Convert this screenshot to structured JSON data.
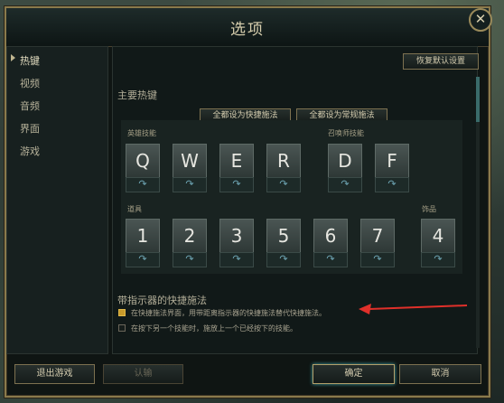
{
  "dialog": {
    "title": "选项",
    "close_icon": "✕"
  },
  "sidebar": {
    "items": [
      {
        "label": "热键",
        "active": true
      },
      {
        "label": "视频",
        "active": false
      },
      {
        "label": "音频",
        "active": false
      },
      {
        "label": "界面",
        "active": false
      },
      {
        "label": "游戏",
        "active": false
      }
    ]
  },
  "content": {
    "restore_defaults": "恢复默认设置",
    "main_hotkeys_title": "主要热键",
    "all_quick_cast": "全都设为快捷施法",
    "all_normal_cast": "全都设为常规施法",
    "champion_abilities_label": "英雄技能",
    "summoner_spells_label": "召唤师技能",
    "items_label": "道具",
    "trinket_label": "饰品",
    "champion_keys": [
      "Q",
      "W",
      "E",
      "R"
    ],
    "summoner_keys": [
      "D",
      "F"
    ],
    "item_keys": [
      "1",
      "2",
      "3",
      "5",
      "6",
      "7"
    ],
    "trinket_key": "4",
    "sub_glyph": "↷",
    "indicator_section_title": "带指示器的快捷施法",
    "option1_text": "在快捷施法界面，用带距离指示器的快捷施法替代快捷施法。",
    "option1_checked": true,
    "option2_text": "在按下另一个技能时，施放上一个已经按下的技能。",
    "option2_checked": false
  },
  "footer": {
    "exit_game": "退出游戏",
    "surrender": "认输",
    "ok": "确定",
    "cancel": "取消"
  },
  "colors": {
    "accent_gold": "#8a7a4c",
    "checkbox_on": "#c89a2a",
    "arrow_red": "#e0302a"
  }
}
